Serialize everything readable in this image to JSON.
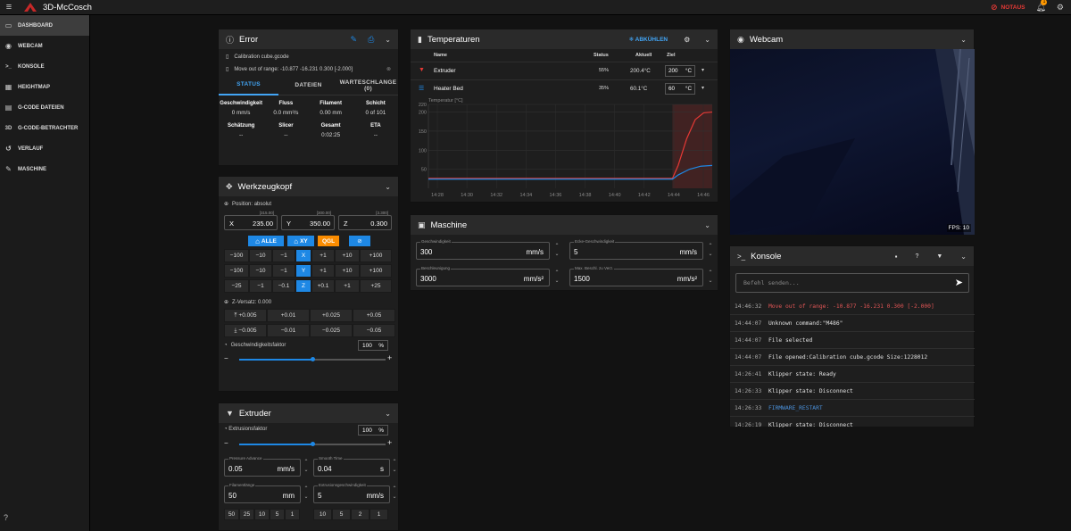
{
  "topbar": {
    "title": "3D-McCosch",
    "notaus": "NOTAUS",
    "notif_count": "1"
  },
  "sidebar": {
    "items": [
      {
        "label": "DASHBOARD",
        "icon": "monitor-icon",
        "ic": "▭"
      },
      {
        "label": "WEBCAM",
        "icon": "webcam-icon",
        "ic": "◉"
      },
      {
        "label": "KONSOLE",
        "icon": "console-icon",
        "ic": ">_"
      },
      {
        "label": "HEIGHTMAP",
        "icon": "grid-icon",
        "ic": "▦"
      },
      {
        "label": "G-CODE DATEIEN",
        "icon": "file-icon",
        "ic": "▤"
      },
      {
        "label": "G-CODE-BETRACHTER",
        "icon": "3d-icon",
        "ic": "3D"
      },
      {
        "label": "VERLAUF",
        "icon": "history-icon",
        "ic": "↺"
      },
      {
        "label": "MASCHINE",
        "icon": "wrench-icon",
        "ic": "✎"
      }
    ]
  },
  "status": {
    "title": "Error",
    "file": "Calibration cube.gcode",
    "message": "Move out of range: -10.877 -16.231 0.300 [-2.000]",
    "tabs": [
      "STATUS",
      "DATEIEN",
      "WARTESCHLANGE (0)"
    ],
    "stats1": [
      {
        "label": "Geschwindigkeit",
        "value": "0 mm/s"
      },
      {
        "label": "Fluss",
        "value": "0.0 mm³/s"
      },
      {
        "label": "Filament",
        "value": "0.00 mm"
      },
      {
        "label": "Schicht",
        "value": "0 of 101"
      }
    ],
    "stats2": [
      {
        "label": "Schätzung",
        "value": "--"
      },
      {
        "label": "Slicer",
        "value": "--"
      },
      {
        "label": "Gesamt",
        "value": "0:02:25"
      },
      {
        "label": "ETA",
        "value": "--"
      }
    ]
  },
  "toolhead": {
    "title": "Werkzeugkopf",
    "position_label": "Position: absolut",
    "axes": [
      {
        "name": "X",
        "value": "235.00",
        "max": "[315.00]"
      },
      {
        "name": "Y",
        "value": "350.00",
        "max": "[300.00]"
      },
      {
        "name": "Z",
        "value": "0.300",
        "max": "[3.300]"
      }
    ],
    "home_buttons": [
      "ALLE",
      "XY",
      "QGL"
    ],
    "jog_rows": [
      [
        "−100",
        "−10",
        "−1",
        "X",
        "+1",
        "+10",
        "+100"
      ],
      [
        "−100",
        "−10",
        "−1",
        "Y",
        "+1",
        "+10",
        "+100"
      ],
      [
        "−25",
        "−1",
        "−0.1",
        "Z",
        "+0.1",
        "+1",
        "+25"
      ]
    ],
    "zoffset_label": "Z-Versatz: 0.000",
    "zoff_up": [
      "+0.005",
      "+0.01",
      "+0.025",
      "+0.05"
    ],
    "zoff_down": [
      "−0.005",
      "−0.01",
      "−0.025",
      "−0.05"
    ],
    "speed_label": "Geschwindigkeitsfaktor",
    "speed_value": "100",
    "speed_unit": "%",
    "speed_fraction": 0.5
  },
  "extruder": {
    "title": "Extruder",
    "factor_label": "Extrusionsfaktor",
    "factor_value": "100",
    "factor_unit": "%",
    "factor_fraction": 0.5,
    "pa_label": "Pressure Advance",
    "pa_value": "0.05",
    "pa_unit": "mm/s",
    "st_label": "Smooth Time",
    "st_value": "0.04",
    "st_unit": "s",
    "fl_label": "Filamentlänge",
    "fl_value": "50",
    "fl_unit": "mm",
    "es_label": "Extrusionsgeschwindigkeit",
    "es_value": "5",
    "es_unit": "mm/s",
    "len_buttons": [
      "50",
      "25",
      "10",
      "5",
      "1"
    ],
    "spd_buttons": [
      "10",
      "5",
      "2",
      "1"
    ]
  },
  "temps": {
    "title": "Temperaturen",
    "cooldown": "ABKÜHLEN",
    "headers": [
      "Name",
      "Status",
      "Aktuell",
      "Ziel"
    ],
    "rows": [
      {
        "name": "Extruder",
        "status": "55%",
        "current": "200.4°C",
        "target": "200",
        "unit": "°C"
      },
      {
        "name": "Heater Bed",
        "status": "35%",
        "current": "60.1°C",
        "target": "60",
        "unit": "°C"
      }
    ],
    "chart_ylabel": "Temperatur [°C]"
  },
  "chart_data": {
    "type": "line",
    "ylabel": "Temperatur [°C]",
    "ylim": [
      0,
      220
    ],
    "yticks": [
      50,
      100,
      150,
      200,
      220
    ],
    "xticks": [
      "14:28",
      "14:30",
      "14:32",
      "14:34",
      "14:36",
      "14:38",
      "14:40",
      "14:42",
      "14:44",
      "14:46"
    ],
    "series": [
      {
        "name": "Extruder",
        "color": "#e53935",
        "x": [
          0,
          0.86,
          0.88,
          0.91,
          0.94,
          0.97,
          1.0
        ],
        "values": [
          26,
          26,
          60,
          130,
          180,
          198,
          200
        ]
      },
      {
        "name": "Heater Bed",
        "color": "#1e88e5",
        "x": [
          0,
          0.86,
          0.88,
          0.92,
          0.96,
          1.0
        ],
        "values": [
          24,
          24,
          35,
          50,
          58,
          60
        ]
      }
    ]
  },
  "machine": {
    "title": "Maschine",
    "fields": [
      {
        "label": "Geschwindigkeit",
        "value": "300",
        "unit": "mm/s"
      },
      {
        "label": "Ecke-Geschwindigkeit",
        "value": "5",
        "unit": "mm/s"
      },
      {
        "label": "Beschleunigung",
        "value": "3000",
        "unit": "mm/s²"
      },
      {
        "label": "Max. Beschl. zu Verz.",
        "value": "1500",
        "unit": "mm/s²"
      }
    ]
  },
  "webcam": {
    "title": "Webcam",
    "fps": "FPS: 10"
  },
  "console": {
    "title": "Konsole",
    "placeholder": "Befehl senden...",
    "lines": [
      {
        "ts": "14:46:32",
        "msg": "Move out of range: -10.877 -16.231 0.300 [-2.000]",
        "color": "#e05555"
      },
      {
        "ts": "14:44:07",
        "msg": "Unknown command:\"M486\"",
        "color": "#e0e0e0"
      },
      {
        "ts": "14:44:07",
        "msg": "File selected",
        "color": "#e0e0e0"
      },
      {
        "ts": "14:44:07",
        "msg": "File opened:Calibration cube.gcode Size:1228012",
        "color": "#e0e0e0"
      },
      {
        "ts": "14:26:41",
        "msg": "Klipper state: Ready",
        "color": "#e0e0e0"
      },
      {
        "ts": "14:26:33",
        "msg": "Klipper state: Disconnect",
        "color": "#e0e0e0"
      },
      {
        "ts": "14:26:33",
        "msg": "FIRMWARE_RESTART",
        "color": "#4a90d9"
      },
      {
        "ts": "14:26:19",
        "msg": "Klipper state: Disconnect",
        "color": "#e0e0e0"
      }
    ]
  }
}
